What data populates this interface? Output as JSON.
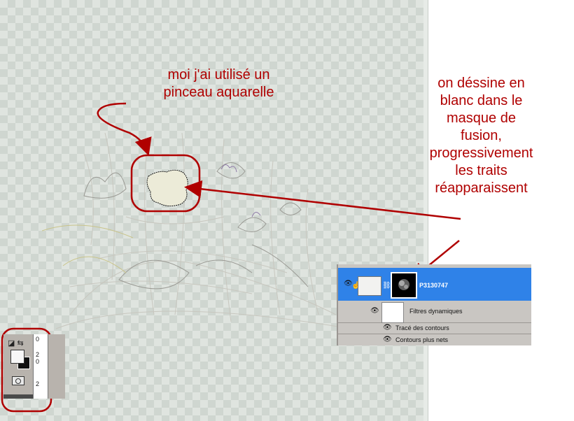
{
  "annotations": {
    "left_note": [
      "moi j'ai utilisé un",
      "pinceau aquarelle"
    ],
    "right_note": [
      "on déssine en",
      "blanc dans le",
      "masque de",
      "fusion,",
      "progressivement",
      "les traits",
      "réapparaissent"
    ]
  },
  "colors": {
    "annotation": "#b00000",
    "selected_layer": "#2f82e8",
    "panel": "#c9c6c2"
  },
  "layers_panel": {
    "layer_name": "P3130747",
    "smart_filters_label": "Filtres dynamiques",
    "filters": [
      "Tracé des contours",
      "Contours plus nets"
    ]
  },
  "tools_panel": {
    "ruler_labels": [
      "0",
      "2",
      "0",
      "2"
    ],
    "fg_color": "#f7f7f7",
    "bg_color": "#111111"
  }
}
